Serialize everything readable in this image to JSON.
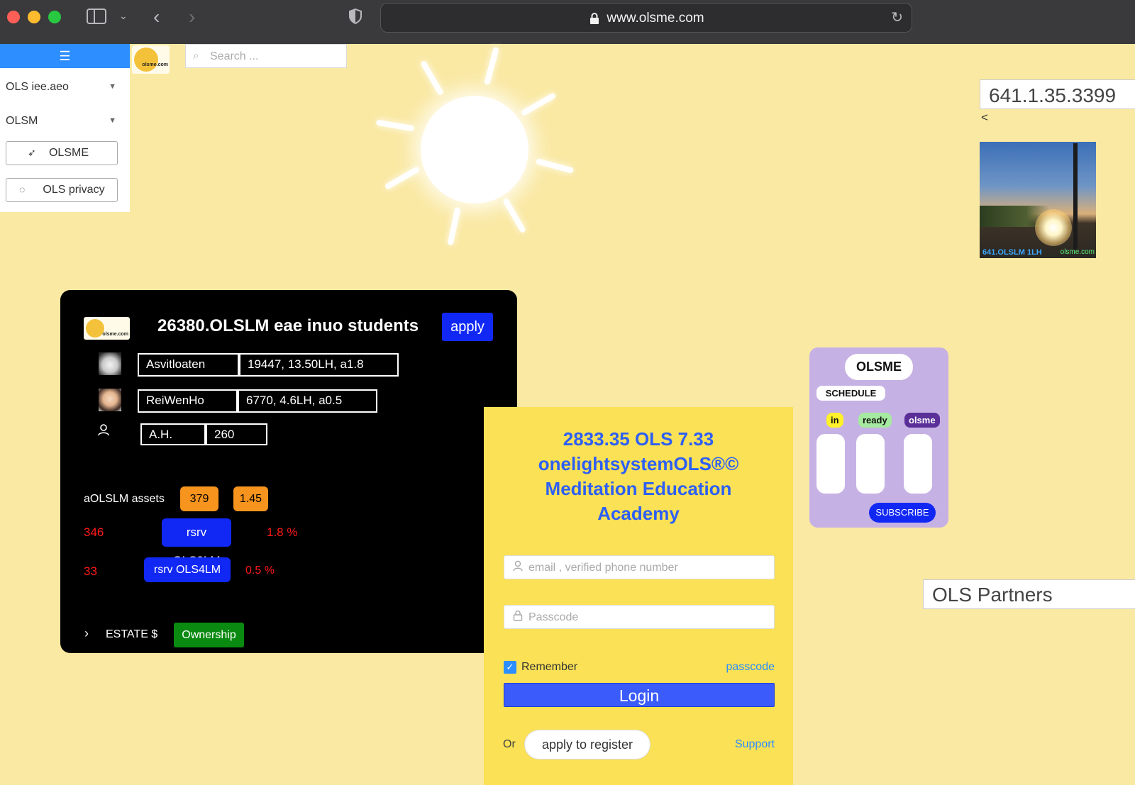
{
  "browser": {
    "url": "www.olsme.com"
  },
  "sidebar": {
    "items": [
      {
        "label": "OLS iee.aeo"
      },
      {
        "label": "OLSM"
      }
    ],
    "buttons": [
      {
        "label": "OLSME"
      },
      {
        "label": "OLS privacy"
      }
    ]
  },
  "logo": {
    "text": "olsme.com"
  },
  "search": {
    "placeholder": "Search ..."
  },
  "right": {
    "phone": "641.1.35.3399",
    "back": "<",
    "photo_caption": "641.OLSLM 1LH",
    "photo_site": "olsme.com",
    "partners": "OLS Partners"
  },
  "students_card": {
    "title": "26380.OLSLM eae inuo students",
    "apply_label": "apply",
    "rows": [
      {
        "name": "Asvitloaten",
        "stats": "19447, 13.50LH, a1.8"
      },
      {
        "name": "ReiWenHo",
        "stats": "6770, 4.6LH, a0.5"
      },
      {
        "name": "A.H.",
        "stats": "260"
      }
    ],
    "assets_label": "aOLSLM assets",
    "assets_values": [
      "379",
      "1.45"
    ],
    "reserves": [
      {
        "count": "346",
        "label": "rsrv OLS9LM",
        "pct": "1.8 %"
      },
      {
        "count": "33",
        "label": "rsrv OLS4LM",
        "pct": "0.5 %"
      }
    ],
    "estate_label": "ESTATE $",
    "ownership_label": "Ownership"
  },
  "login": {
    "title_lines": [
      "2833.35 OLS 7.33",
      "onelightsystemOLS®©",
      "Meditation Education",
      "Academy"
    ],
    "email_placeholder": "email , verified phone number",
    "passcode_placeholder": "Passcode",
    "remember_label": "Remember",
    "passcode_link": "passcode",
    "login_label": "Login",
    "or_label": "Or",
    "register_label": "apply to register",
    "support_label": "Support"
  },
  "schedule_card": {
    "title": "OLSME",
    "schedule_label": "SCHEDULE",
    "tags": [
      "in",
      "ready",
      "olsme"
    ],
    "subscribe_label": "SUBSCRIBE"
  },
  "colors": {
    "page_bg": "#fae9a3",
    "sidebar_accent": "#2c8eff",
    "apply_blue": "#1128f5",
    "asset_orange": "#f7941d",
    "reserve_red": "#ff1a1a",
    "ownership_green": "#0a8a10",
    "login_bg": "#fae155",
    "login_title": "#2d5ff5",
    "login_button": "#3b5bfa",
    "schedule_bg": "#c6b1e4"
  },
  "icons": [
    "sidebar-icon",
    "chevron-down-icon",
    "back-arrow-icon",
    "forward-arrow-icon",
    "shield-icon",
    "lock-icon",
    "reload-icon",
    "menu-toggle-icon",
    "rocket-icon",
    "privacy-icon",
    "search-icon",
    "user-icon",
    "chevron-right-icon",
    "checkbox-icon"
  ]
}
